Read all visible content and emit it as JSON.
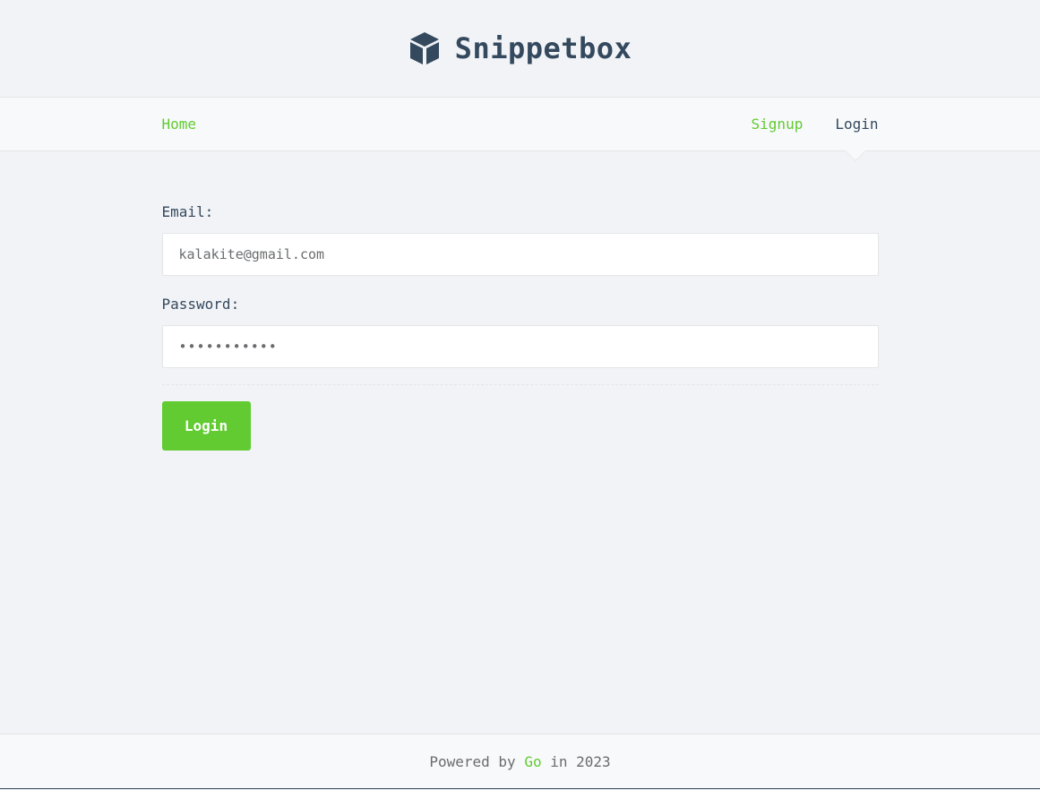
{
  "brand": {
    "title": "Snippetbox",
    "icon": "cube-icon"
  },
  "nav": {
    "home_label": "Home",
    "signup_label": "Signup",
    "login_label": "Login",
    "active": "login"
  },
  "form": {
    "email_label": "Email:",
    "email_value": "kalakite@gmail.com",
    "password_label": "Password:",
    "password_value": "•••••••••••",
    "submit_label": "Login"
  },
  "footer": {
    "prefix": "Powered by ",
    "link_label": "Go",
    "suffix": " in 2023"
  },
  "colors": {
    "accent": "#62cb31",
    "text": "#34495e",
    "background": "#f1f3f6"
  }
}
